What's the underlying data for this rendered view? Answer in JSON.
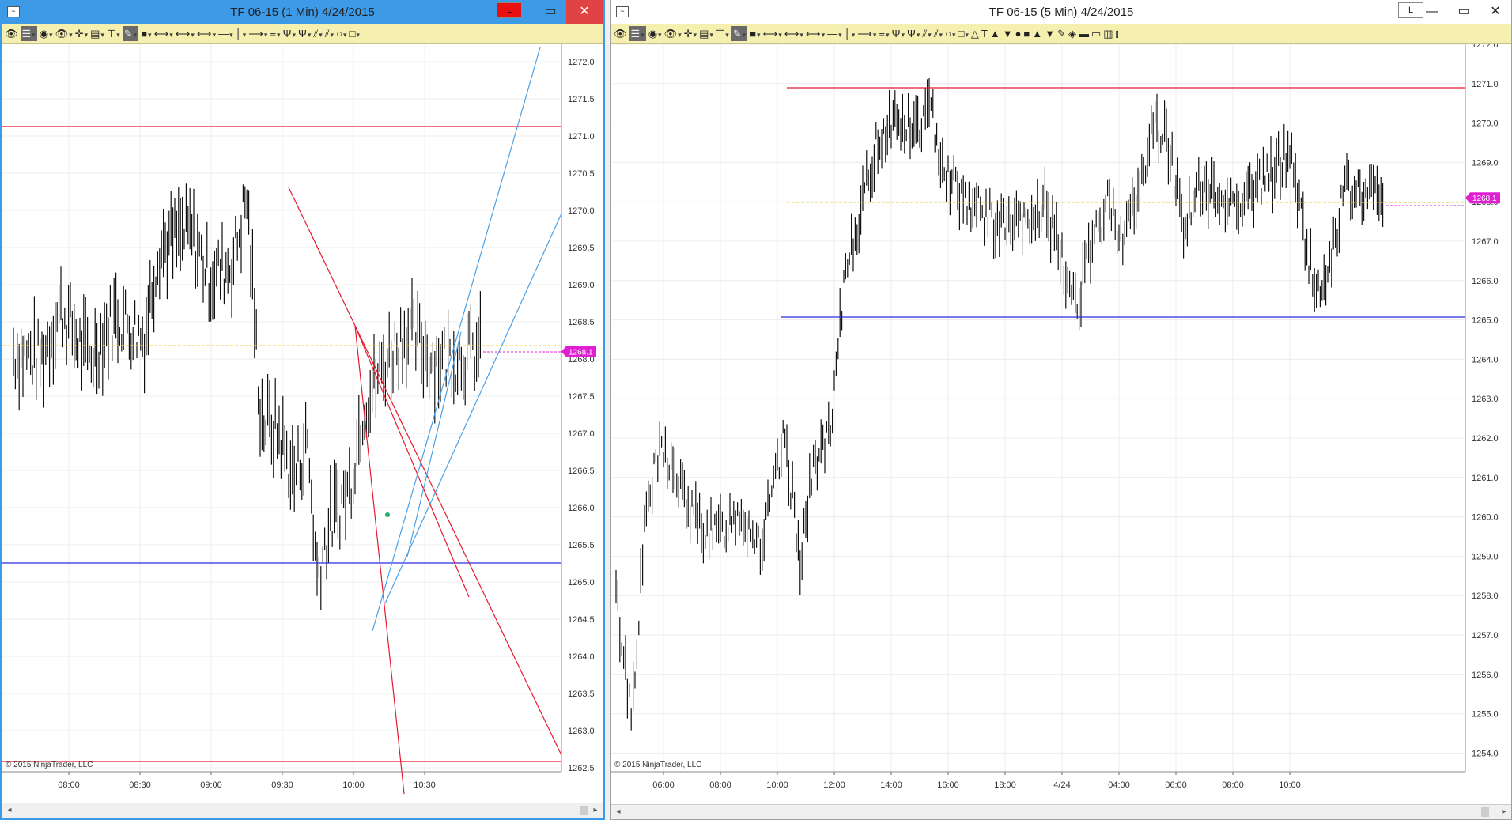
{
  "windows": [
    {
      "id": "w1",
      "title": "TF 06-15 (1 Min)  4/24/2015",
      "badge": "L",
      "controls": [
        "▭",
        "✕"
      ],
      "price_labels": [
        "1272.0",
        "1271.5",
        "1271.0",
        "1270.5",
        "1270.0",
        "1269.5",
        "1269.0",
        "1268.5",
        "1268.0",
        "1267.5",
        "1267.0",
        "1266.5",
        "1266.0",
        "1265.5",
        "1265.0",
        "1264.5",
        "1264.0",
        "1263.5",
        "1263.0",
        "1262.5"
      ],
      "time_labels": [
        "08:00",
        "08:30",
        "09:00",
        "09:30",
        "10:00",
        "10:30"
      ],
      "last_price": "1268.1",
      "copyright": "© 2015 NinjaTrader, LLC"
    },
    {
      "id": "w2",
      "title": "TF 06-15 (5 Min)  4/24/2015",
      "badge": "L",
      "controls": [
        "—",
        "▭",
        "✕"
      ],
      "price_labels": [
        "1272.0",
        "1271.0",
        "1270.0",
        "1269.0",
        "1268.0",
        "1267.0",
        "1266.0",
        "1265.0",
        "1264.0",
        "1263.0",
        "1262.0",
        "1261.0",
        "1260.0",
        "1259.0",
        "1258.0",
        "1257.0",
        "1256.0",
        "1255.0",
        "1254.0"
      ],
      "time_labels": [
        "06:00",
        "08:00",
        "10:00",
        "12:00",
        "14:00",
        "16:00",
        "18:00",
        "4/24",
        "04:00",
        "06:00",
        "08:00",
        "10:00"
      ],
      "last_price": "1268.1",
      "copyright": "© 2015 NinjaTrader, LLC"
    }
  ],
  "toolbar1": [
    "👁",
    "☰",
    "◉",
    "👁",
    "✛",
    "▤",
    "⊤",
    "✎",
    "■",
    "⟷",
    "⟷",
    "⟷",
    "—",
    "│",
    "⟶",
    "≡",
    "Ψ",
    "Ψ",
    "⫽",
    "⫽",
    "○",
    "□"
  ],
  "toolbar2": [
    "👁",
    "☰",
    "◉",
    "👁",
    "✛",
    "▤",
    "⊤",
    "✎",
    "■",
    "⟷",
    "⟷",
    "⟷",
    "—",
    "│",
    "⟶",
    "≡",
    "Ψ",
    "Ψ",
    "⫽",
    "⫽",
    "○",
    "□",
    "△",
    "T",
    "▲",
    "▼",
    "●",
    "■",
    "▲",
    "▼",
    "✎",
    "◈",
    "▬",
    "▭",
    "▥",
    "⫾"
  ],
  "colors": {
    "active_title": "#3c9ae6",
    "red_line": "#e8182c",
    "blue_line": "#2a2ae0",
    "trend_blue": "#4aa0e8",
    "yellow_line": "#e8d040",
    "last_price_bg": "#e020d0"
  }
}
